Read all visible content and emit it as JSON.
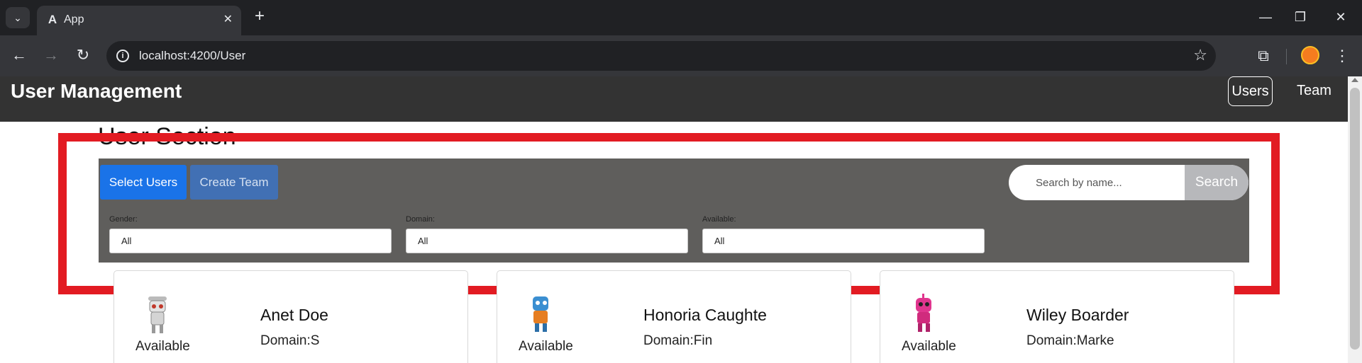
{
  "browser": {
    "tab_title": "App",
    "url": "localhost:4200/User"
  },
  "header": {
    "title": "User Management",
    "nav": [
      {
        "label": "Users",
        "active": true
      },
      {
        "label": "Team",
        "active": false
      }
    ]
  },
  "section": {
    "title": "User Section"
  },
  "toolbar": {
    "select_users_label": "Select Users",
    "create_team_label": "Create Team",
    "search_placeholder": "Search by name...",
    "search_button_label": "Search"
  },
  "filters": [
    {
      "label": "Gender:",
      "value": "All"
    },
    {
      "label": "Domain:",
      "value": "All"
    },
    {
      "label": "Available:",
      "value": "All"
    }
  ],
  "users": [
    {
      "name": "Anet Doe",
      "status": "Available",
      "domain": "Domain:S",
      "avatar_color": "#d9d9d9"
    },
    {
      "name": "Honoria Caughte",
      "status": "Available",
      "domain": "Domain:Fin",
      "avatar_color": "#3b8fd1"
    },
    {
      "name": "Wiley Boarder",
      "status": "Available",
      "domain": "Domain:Marke",
      "avatar_color": "#e0358e"
    }
  ],
  "colors": {
    "primary": "#1a73e8",
    "secondary": "#4170b4",
    "highlight": "#e21b22",
    "header_bg": "#333333",
    "panel_bg": "#5f5e5c"
  }
}
